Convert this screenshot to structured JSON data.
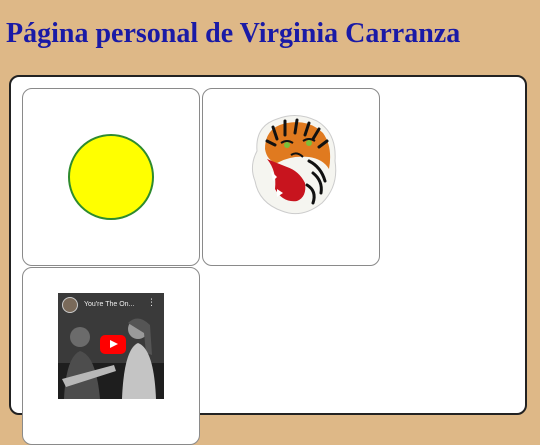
{
  "page": {
    "title": "Página personal de Virginia Carranza",
    "background_color": "#deb887",
    "title_color": "#1a1aa6"
  },
  "cards": {
    "circle": {
      "fill_color": "#ffff00",
      "stroke_color": "#2e8b2e"
    },
    "tiger": {
      "icon": "tiger-head-illustration"
    },
    "video": {
      "title": "You're The On...",
      "menu_icon": "vertical-dots-icon",
      "play_icon": "youtube-play-icon"
    }
  }
}
